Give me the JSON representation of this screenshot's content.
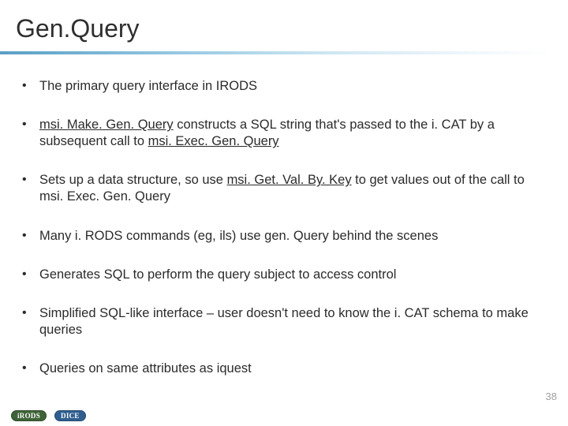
{
  "title": "Gen.Query",
  "bullets": [
    {
      "plain": "The primary query interface in IRODS"
    },
    {
      "html": "<span class=\"u\">msi. Make. Gen. Query</span> constructs a SQL string that's passed to the i. CAT by a subsequent call to <span class=\"u\">msi. Exec. Gen. Query</span>"
    },
    {
      "html": "Sets up a data structure, so use <span class=\"u\">msi. Get. Val. By. Key</span> to get values out of the call to msi. Exec. Gen. Query"
    },
    {
      "plain": "Many i. RODS commands (eg, ils) use gen. Query behind the scenes"
    },
    {
      "plain": "Generates SQL to perform the query subject to access control"
    },
    {
      "plain": "Simplified SQL-like interface – user doesn't need to know the i. CAT schema to make queries"
    },
    {
      "plain": "Queries on same attributes as iquest"
    }
  ],
  "pageNumber": "38",
  "badges": {
    "irods": "iRODS",
    "dice": "DICE"
  }
}
